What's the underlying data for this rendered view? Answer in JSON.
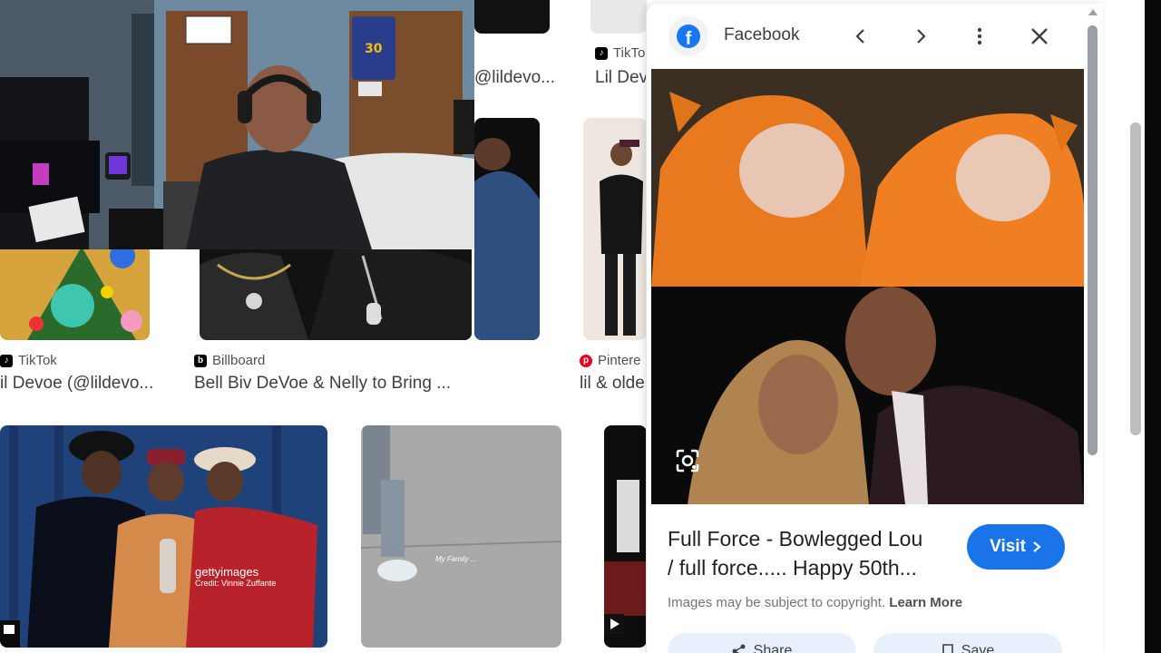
{
  "grid": {
    "row0": [
      {
        "title": "@lildevo...",
        "source": ""
      },
      {
        "title": "Lil Dev",
        "source": "TikTo"
      }
    ],
    "row1": [
      {
        "title": "il Devoe (@lildevo...",
        "source": "TikTok",
        "fav_color": "#000000"
      },
      {
        "title": "Bell Biv DeVoe & Nelly to Bring ...",
        "source": "Billboard",
        "fav_color": "#000000"
      },
      {
        "title": "lil & olde",
        "source": "Pintere",
        "fav_color": "#e60023"
      }
    ],
    "row2": {
      "getty_label": "gettyimages",
      "getty_credit": "Credit: Vinnie Zuffante",
      "handwriting": "My Family ..."
    }
  },
  "panel": {
    "site_name": "Facebook",
    "site_icon": "facebook-icon",
    "back_icon": "chevron-left-icon",
    "forward_icon": "chevron-right-icon",
    "more_icon": "more-vert-icon",
    "close_icon": "close-icon",
    "lens_icon": "google-lens-icon",
    "title_line1": "Full Force - Bowlegged Lou",
    "title_line2": "/ full force..... Happy 50th...",
    "visit_label": "Visit",
    "copyright_text": "Images may be subject to copyright.",
    "learn_more": "Learn More",
    "share_label": "Share",
    "save_label": "Save",
    "accent": "#1a73e8"
  }
}
